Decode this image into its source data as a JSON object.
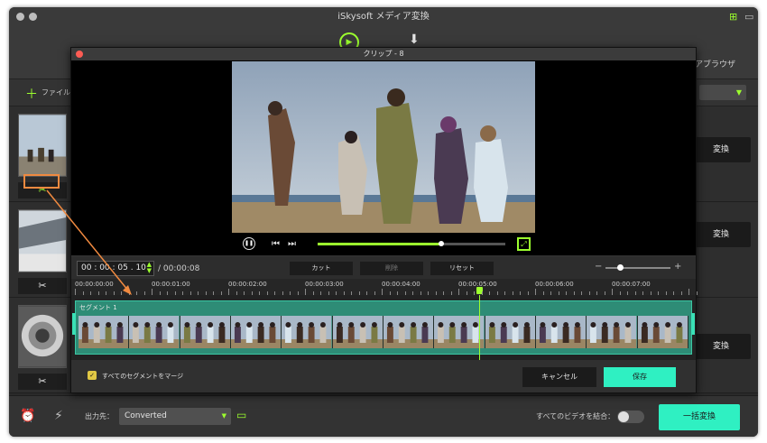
{
  "window": {
    "title": "iSkysoft メディア変換"
  },
  "toolbar": {
    "browser_label": "アブラウザ"
  },
  "file_bar": {
    "add_files_label": "ファイル"
  },
  "rows": [
    {
      "convert_label": "変換"
    },
    {
      "convert_label": "変換"
    },
    {
      "convert_label": "変換"
    }
  ],
  "bottom": {
    "output_label": "出力先：",
    "output_value": "Converted",
    "merge_label": "すべてのビデオを結合：",
    "batch_label": "一括変換"
  },
  "dialog": {
    "title": "クリップ - 8",
    "current_time": "00 : 00 : 05 . 10",
    "total_time": "/ 00:00:08",
    "cut_label": "カット",
    "delete_label": "削除",
    "reset_label": "リセット",
    "progress": 0.66,
    "zoom": 0.22,
    "playhead_fraction": 0.655,
    "ruler_labels": [
      "00:00:00:00",
      "00:00:01:00",
      "00:00:02:00",
      "00:00:03:00",
      "00:00:04:00",
      "00:00:05:00",
      "00:00:06:00",
      "00:00:07:00"
    ],
    "segment_label": "セグメント 1",
    "merge_label": "すべてのセグメントをマージ",
    "cancel_label": "キャンセル",
    "save_label": "保存"
  },
  "icons": {
    "convert_tool": "play-circle-icon",
    "download_tool": "download-arrow-icon",
    "trim": "scissors-icon",
    "alarm": "alarm-clock-icon",
    "speed": "lightning-icon",
    "folder": "folder-icon"
  },
  "colors": {
    "accent_green": "#9cff2e",
    "accent_teal": "#2ff0c2",
    "close_red": "#fd5c54",
    "highlight_orange": "#f08a40"
  }
}
